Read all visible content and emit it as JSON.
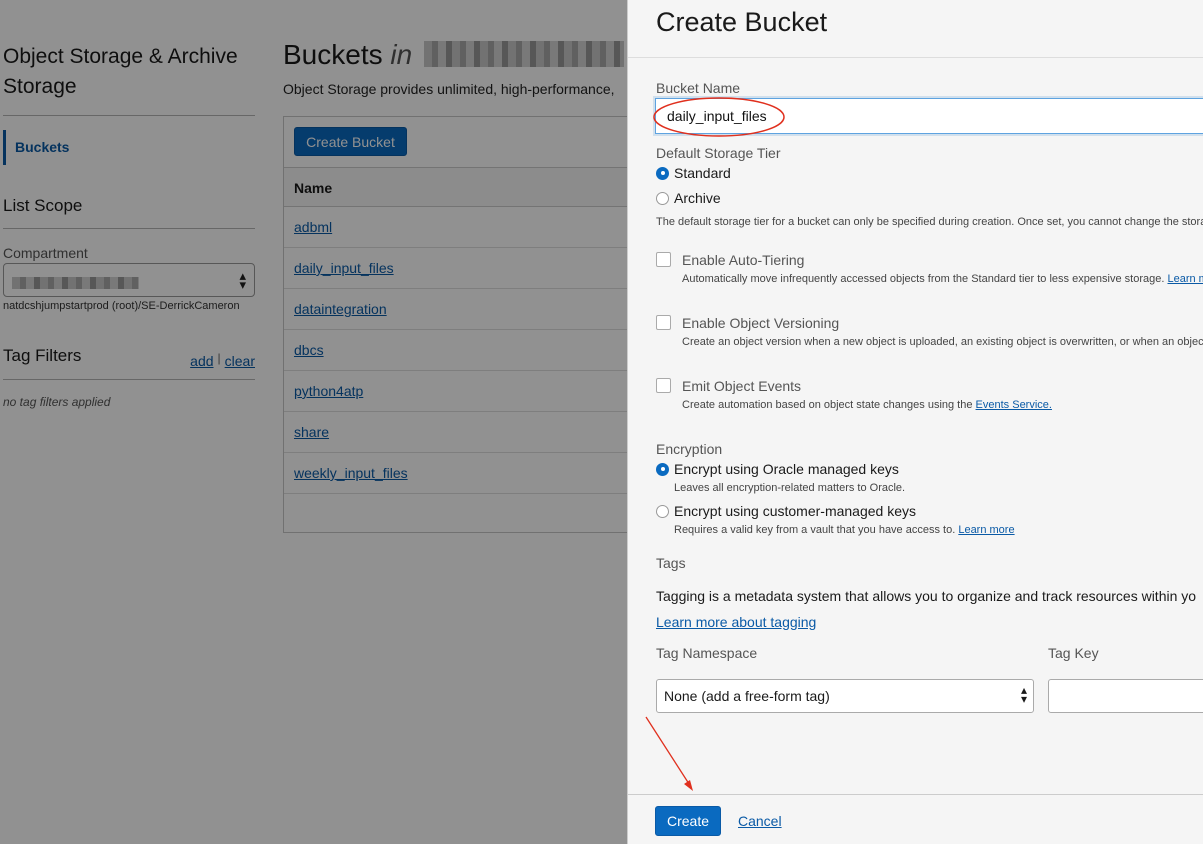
{
  "background": {
    "nav": {
      "title": "Object Storage & Archive Storage",
      "active_item": "Buckets",
      "list_scope_heading": "List Scope",
      "compartment_label": "Compartment",
      "compartment_path": "natdcshjumpstartprod (root)/SE-DerrickCameron",
      "tag_filters_heading": "Tag Filters",
      "add_link": "add",
      "separator": "|",
      "clear_link": "clear",
      "no_tags": "no tag filters applied"
    },
    "main": {
      "title": "Buckets",
      "title_in": "in",
      "description": "Object Storage provides unlimited, high-performance,",
      "create_button": "Create Bucket",
      "table_header": "Name",
      "buckets": [
        "adbml",
        "daily_input_files",
        "dataintegration",
        "dbcs",
        "python4atp",
        "share",
        "weekly_input_files"
      ]
    }
  },
  "panel": {
    "title": "Create Bucket",
    "bucket_name_label": "Bucket Name",
    "bucket_name_value": "daily_input_files",
    "storage_tier_label": "Default Storage Tier",
    "tier_standard": "Standard",
    "tier_archive": "Archive",
    "tier_help": "The default storage tier for a bucket can only be specified during creation. Once set, you cannot change the stora",
    "auto_tiering_label": "Enable Auto-Tiering",
    "auto_tiering_help": "Automatically move infrequently accessed objects from the Standard tier to less expensive storage.",
    "auto_tiering_link": "Learn m",
    "versioning_label": "Enable Object Versioning",
    "versioning_help": "Create an object version when a new object is uploaded, an existing object is overwritten, or when an object",
    "events_label": "Emit Object Events",
    "events_help": "Create automation based on object state changes using the",
    "events_link": "Events Service.",
    "encryption_label": "Encryption",
    "enc_oracle": "Encrypt using Oracle managed keys",
    "enc_oracle_help": "Leaves all encryption-related matters to Oracle.",
    "enc_customer": "Encrypt using customer-managed keys",
    "enc_customer_help": "Requires a valid key from a vault that you have access to.",
    "enc_customer_link": "Learn more",
    "tags_label": "Tags",
    "tags_description": "Tagging is a metadata system that allows you to organize and track resources within yo",
    "tags_link": "Learn more about tagging",
    "tag_namespace_label": "Tag Namespace",
    "tag_key_label": "Tag Key",
    "tag_namespace_value": "None (add a free-form tag)",
    "create_button": "Create",
    "cancel_link": "Cancel"
  },
  "colors": {
    "accent": "#0a6ac0",
    "link": "#0a5aa6",
    "annotation": "#e0301e"
  },
  "icons": [
    "select-arrows-icon",
    "radio-icon",
    "checkbox-icon",
    "arrow-annotation"
  ]
}
